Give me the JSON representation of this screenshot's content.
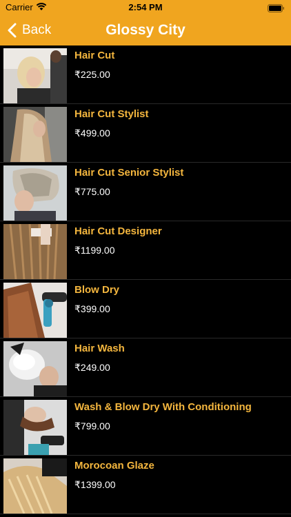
{
  "status_bar": {
    "carrier": "Carrier",
    "time": "2:54 PM"
  },
  "nav": {
    "back_label": "Back",
    "title": "Glossy City"
  },
  "services": [
    {
      "name": "Hair Cut",
      "price": "₹225.00"
    },
    {
      "name": "Hair Cut Stylist",
      "price": "₹499.00"
    },
    {
      "name": "Hair Cut Senior Stylist",
      "price": "₹775.00"
    },
    {
      "name": "Hair Cut Designer",
      "price": "₹1199.00"
    },
    {
      "name": "Blow Dry",
      "price": "₹399.00"
    },
    {
      "name": "Hair Wash",
      "price": "₹249.00"
    },
    {
      "name": "Wash & Blow Dry With Conditioning",
      "price": "₹799.00"
    },
    {
      "name": "Morocoan Glaze",
      "price": "₹1399.00"
    }
  ],
  "colors": {
    "accent": "#f0a51f",
    "service_name": "#f4b63e",
    "background": "#000000"
  }
}
